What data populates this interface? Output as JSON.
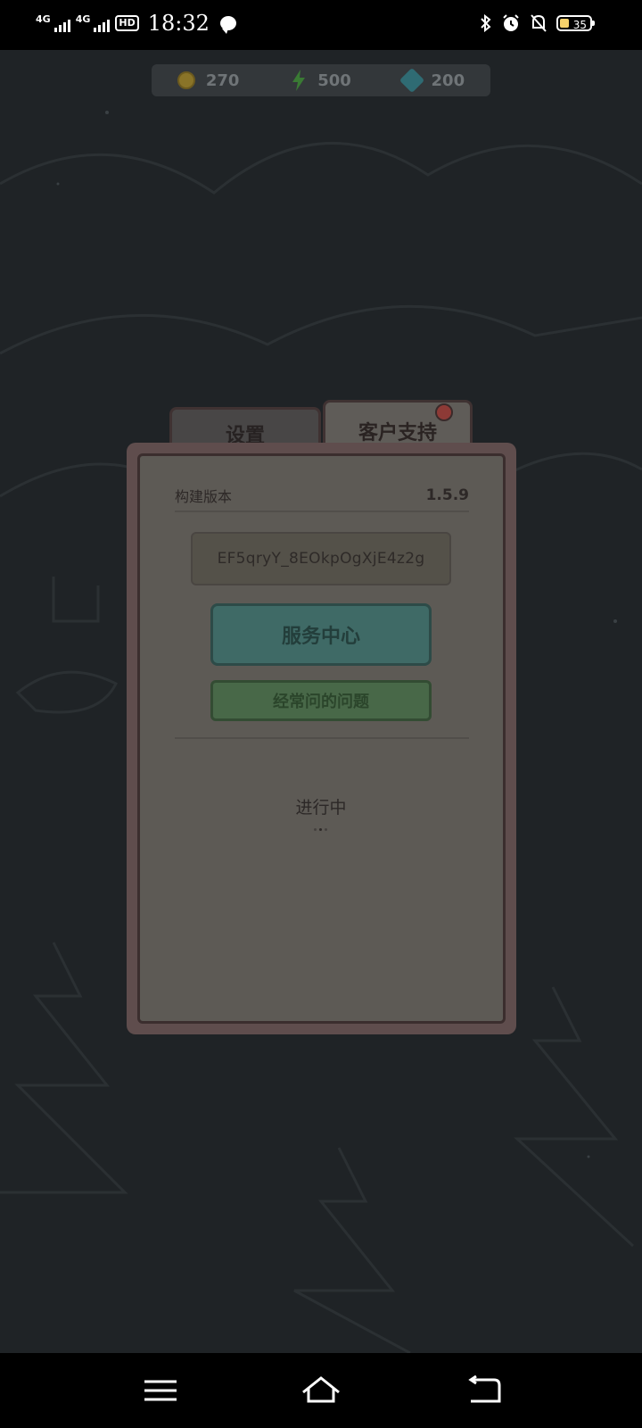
{
  "status_bar": {
    "network_1": "4G",
    "network_2": "4G",
    "hd_badge": "HD",
    "time": "18:32",
    "battery_level": "35",
    "icons": [
      "signal-icon",
      "signal-icon",
      "hd-voice-icon",
      "message-bubble-icon",
      "bluetooth-icon",
      "alarm-icon",
      "mute-icon",
      "battery-icon"
    ]
  },
  "resources": {
    "coins": "270",
    "energy": "500",
    "gems": "200",
    "icons": [
      "coin-icon",
      "lightning-icon",
      "gem-icon"
    ]
  },
  "dialog": {
    "tabs": [
      {
        "label": "设置",
        "active": false
      },
      {
        "label": "客户支持",
        "active": true,
        "has_notification": true
      }
    ],
    "build_version_label": "构建版本",
    "build_version_value": "1.5.9",
    "user_id": "EF5qryY_8EOkpOgXjE4z2g",
    "service_center_button": "服务中心",
    "faq_button": "经常问的问题",
    "progress_text": "进行中"
  },
  "colors": {
    "background": "#1f2326",
    "dialog_frame": "#5f4d4d",
    "service_button": "#3f6a66",
    "faq_button": "#486848",
    "notification_dot": "#8d3a36"
  },
  "nav_bar": {
    "icons": [
      "menu-icon",
      "home-icon",
      "back-icon"
    ]
  }
}
